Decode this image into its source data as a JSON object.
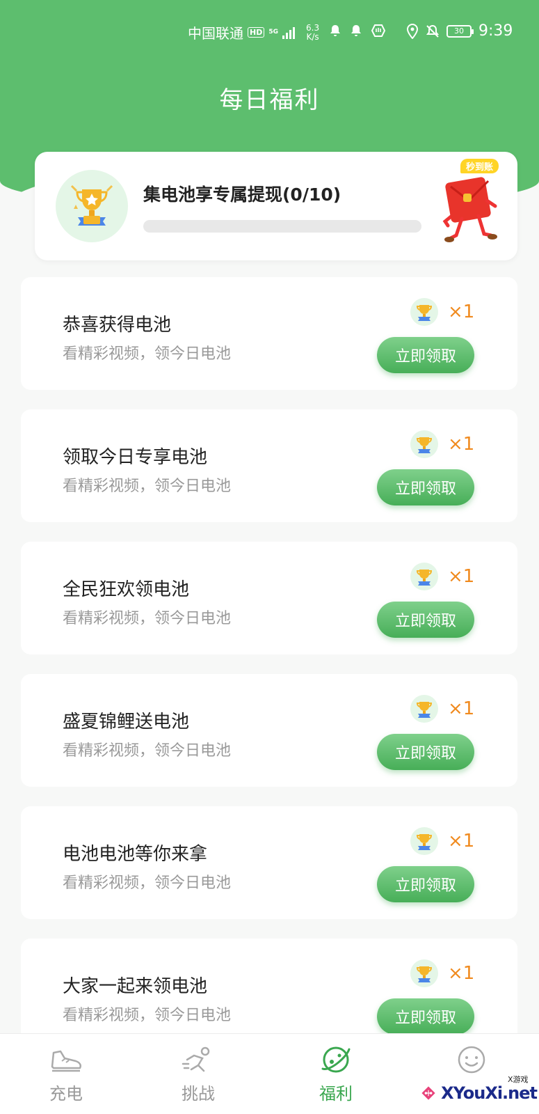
{
  "status_bar": {
    "carrier": "中国联通",
    "hd": "HD",
    "network": "5G",
    "speed_value": "6.3",
    "speed_unit": "K/s",
    "battery": "30",
    "time": "9:39"
  },
  "page_title": "每日福利",
  "progress_card": {
    "title": "集电池享专属提现(0/10)",
    "progress": 0,
    "badge": "秒到账"
  },
  "tasks": [
    {
      "title": "恭喜获得电池",
      "subtitle": "看精彩视频，领今日电池",
      "reward": "×1",
      "button": "立即领取"
    },
    {
      "title": "领取今日专享电池",
      "subtitle": "看精彩视频，领今日电池",
      "reward": "×1",
      "button": "立即领取"
    },
    {
      "title": "全民狂欢领电池",
      "subtitle": "看精彩视频，领今日电池",
      "reward": "×1",
      "button": "立即领取"
    },
    {
      "title": "盛夏锦鲤送电池",
      "subtitle": "看精彩视频，领今日电池",
      "reward": "×1",
      "button": "立即领取"
    },
    {
      "title": "电池电池等你来拿",
      "subtitle": "看精彩视频，领今日电池",
      "reward": "×1",
      "button": "立即领取"
    },
    {
      "title": "大家一起来领电池",
      "subtitle": "看精彩视频，领今日电池",
      "reward": "×1",
      "button": "立即领取"
    }
  ],
  "bottom_nav": [
    {
      "label": "充电",
      "icon": "sneaker-icon",
      "active": false
    },
    {
      "label": "挑战",
      "icon": "runner-icon",
      "active": false
    },
    {
      "label": "福利",
      "icon": "planet-icon",
      "active": true
    },
    {
      "label": "",
      "icon": "smiley-icon",
      "active": false
    }
  ],
  "watermark": {
    "text": "XYouXi.net",
    "sub": "X游戏"
  },
  "colors": {
    "primary": "#5dbe6e",
    "reward": "#f08a1e",
    "badge": "#ffd426"
  }
}
